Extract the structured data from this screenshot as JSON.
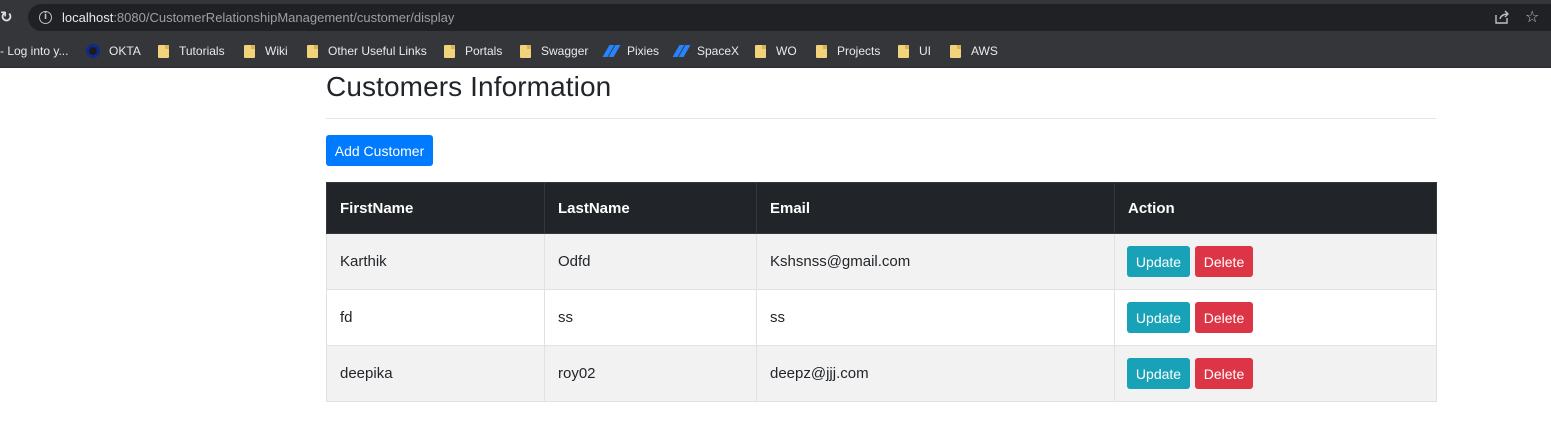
{
  "browser": {
    "url_host": "localhost",
    "url_rest": ":8080/CustomerRelationshipManagement/customer/display",
    "bookmarks": [
      {
        "label": "- Log into y...",
        "icon": "none"
      },
      {
        "label": "OKTA",
        "icon": "okta-icon"
      },
      {
        "label": "Tutorials",
        "icon": "folder-icon"
      },
      {
        "label": "Wiki",
        "icon": "folder-icon"
      },
      {
        "label": "Other Useful Links",
        "icon": "folder-icon"
      },
      {
        "label": "Portals",
        "icon": "folder-icon"
      },
      {
        "label": "Swagger",
        "icon": "folder-icon"
      },
      {
        "label": "Pixies",
        "icon": "jira-icon"
      },
      {
        "label": "SpaceX",
        "icon": "jira-icon"
      },
      {
        "label": "WO",
        "icon": "folder-icon"
      },
      {
        "label": "Projects",
        "icon": "folder-icon"
      },
      {
        "label": "UI",
        "icon": "folder-icon"
      },
      {
        "label": "AWS",
        "icon": "folder-icon"
      }
    ]
  },
  "page": {
    "title": "Customers Information",
    "add_button": "Add Customer"
  },
  "table": {
    "headers": [
      "FirstName",
      "LastName",
      "Email",
      "Action"
    ],
    "rows": [
      {
        "first": "Karthik",
        "last": "Odfd",
        "email": "Kshsnss@gmail.com",
        "update": "Update",
        "delete": "Delete"
      },
      {
        "first": "fd",
        "last": "ss",
        "email": "ss",
        "update": "Update",
        "delete": "Delete"
      },
      {
        "first": "deepika",
        "last": "roy02",
        "email": "deepz@jjj.com",
        "update": "Update",
        "delete": "Delete"
      }
    ]
  },
  "colors": {
    "primary": "#007bff",
    "info": "#17a2b8",
    "danger": "#dc3545",
    "table_header": "#212529"
  }
}
